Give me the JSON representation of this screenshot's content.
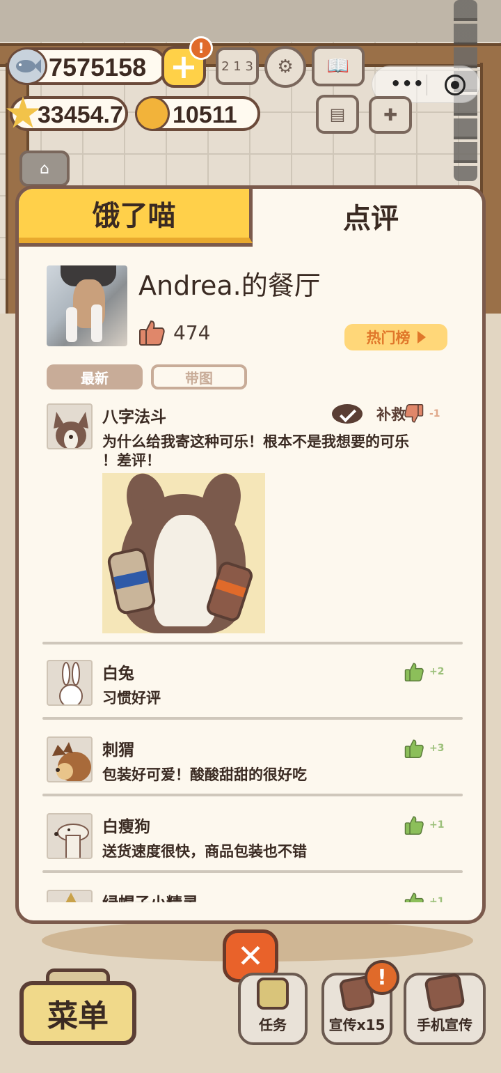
{
  "currency": {
    "fish": "7575158",
    "stars": "33454.7",
    "bells": "10511"
  },
  "panel": {
    "tab_left": "饿了喵",
    "tab_right": "点评",
    "restaurant_name": "Andrea.的餐厅",
    "likes": "474",
    "hot_list": "热门榜",
    "filter_latest": "最新",
    "filter_with_image": "带图"
  },
  "reviews": [
    {
      "name": "八字法斗",
      "text_line1": "为什么给我寄这种可乐！根本不是我想要的可乐",
      "text_line2": "！差评！",
      "reply_label": "补救",
      "vote": "-1",
      "vote_type": "dislike"
    },
    {
      "name": "白兔",
      "text": "习惯好评",
      "vote": "+2",
      "vote_type": "like"
    },
    {
      "name": "刺猬",
      "text": "包装好可爱！酸酸甜甜的很好吃",
      "vote": "+3",
      "vote_type": "like"
    },
    {
      "name": "白瘦狗",
      "text": "送货速度很快，商品包装也不错",
      "vote": "+1",
      "vote_type": "like"
    },
    {
      "name": "绿帽子小精灵",
      "vote": "+1",
      "vote_type": "like"
    }
  ],
  "bottom": {
    "menu": "菜单",
    "task": "任务",
    "promote": "宣传x15",
    "phone_promote": "手机宣传"
  },
  "colors": {
    "tab_active": "#ffd04a",
    "like_green": "#8cbf5a",
    "dislike_orange": "#e0876a",
    "close_red": "#e9622a"
  }
}
